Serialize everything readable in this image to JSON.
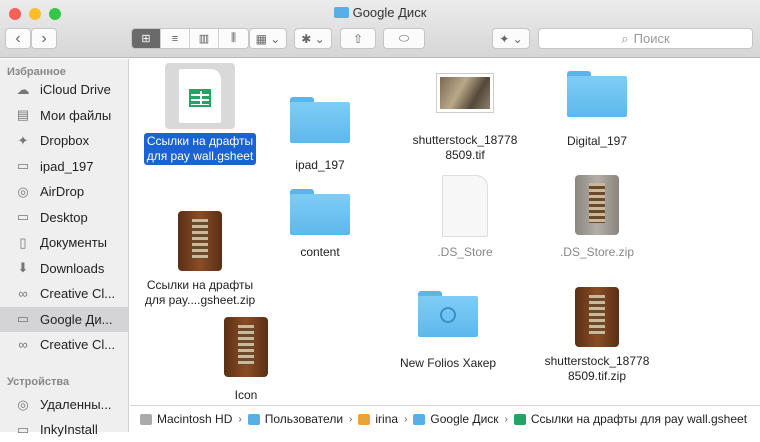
{
  "window": {
    "title": "Google Диск"
  },
  "toolbar": {
    "back": "‹",
    "forward": "›",
    "view_icon": "⊞",
    "view_list": "≡",
    "view_columns": "▥",
    "view_cover": "⫼",
    "arrange": "▦ ⌄",
    "action": "✱ ⌄",
    "share": "⇧",
    "tags": "⬭",
    "dropbox": "✦ ⌄",
    "search_placeholder": "Поиск"
  },
  "sidebar": {
    "favorites_header": "Избранное",
    "favorites": [
      {
        "label": "iCloud Drive",
        "icon": "☁"
      },
      {
        "label": "Мои файлы",
        "icon": "▤"
      },
      {
        "label": "Dropbox",
        "icon": "✦"
      },
      {
        "label": "ipad_197",
        "icon": "▭"
      },
      {
        "label": "AirDrop",
        "icon": "◎"
      },
      {
        "label": "Desktop",
        "icon": "▭"
      },
      {
        "label": "Документы",
        "icon": "▯"
      },
      {
        "label": "Downloads",
        "icon": "⬇"
      },
      {
        "label": "Creative Cl...",
        "icon": "∞"
      },
      {
        "label": "Google Ди...",
        "icon": "▭"
      },
      {
        "label": "Creative Cl...",
        "icon": "∞"
      }
    ],
    "devices_header": "Устройства",
    "devices": [
      {
        "label": "Удаленны...",
        "icon": "◎"
      },
      {
        "label": "InkyInstall",
        "icon": "▭"
      }
    ]
  },
  "files": [
    {
      "line1": "Ссылки на драфты",
      "line2": "для pay wall.gsheet",
      "type": "gsheet"
    },
    {
      "line1": "ipad_197",
      "line2": "",
      "type": "folder"
    },
    {
      "line1": "shutterstock_18778",
      "line2": "8509.tif",
      "type": "image"
    },
    {
      "line1": "Digital_197",
      "line2": "",
      "type": "folder"
    },
    {
      "line1": "Ссылки на драфты",
      "line2": "для pay....gsheet.zip",
      "type": "zip"
    },
    {
      "line1": "content",
      "line2": "",
      "type": "folder"
    },
    {
      "line1": ".DS_Store",
      "line2": "",
      "type": "doc"
    },
    {
      "line1": ".DS_Store.zip",
      "line2": "",
      "type": "zip"
    },
    {
      "line1": "New Folios Хакер",
      "line2": "",
      "type": "folder"
    },
    {
      "line1": "shutterstock_18778",
      "line2": "8509.tif.zip",
      "type": "zip"
    },
    {
      "line1": "Icon",
      "line2": "",
      "type": "zip"
    }
  ],
  "pathbar": [
    "Macintosh HD",
    "Пользователи",
    "irina",
    "Google Диск",
    "Ссылки на драфты для pay wall.gsheet"
  ],
  "pathbar_sep": "›"
}
